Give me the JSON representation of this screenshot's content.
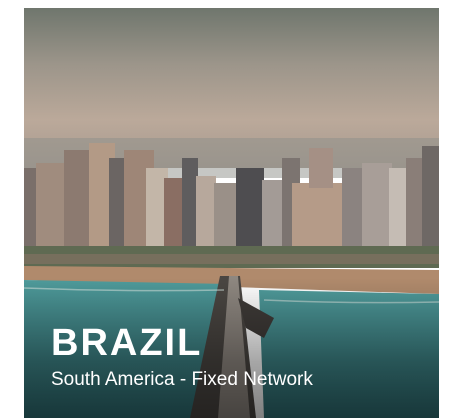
{
  "card": {
    "title": "BRAZIL",
    "subtitle": "South America - Fixed Network",
    "image_semantic": "city-coastline-photo"
  },
  "colors": {
    "text": "#ffffff",
    "sky_top": "#7f8478",
    "sky_mid": "#b9a99a",
    "sea": "#3f8a8c",
    "sand": "#b08a6c"
  }
}
